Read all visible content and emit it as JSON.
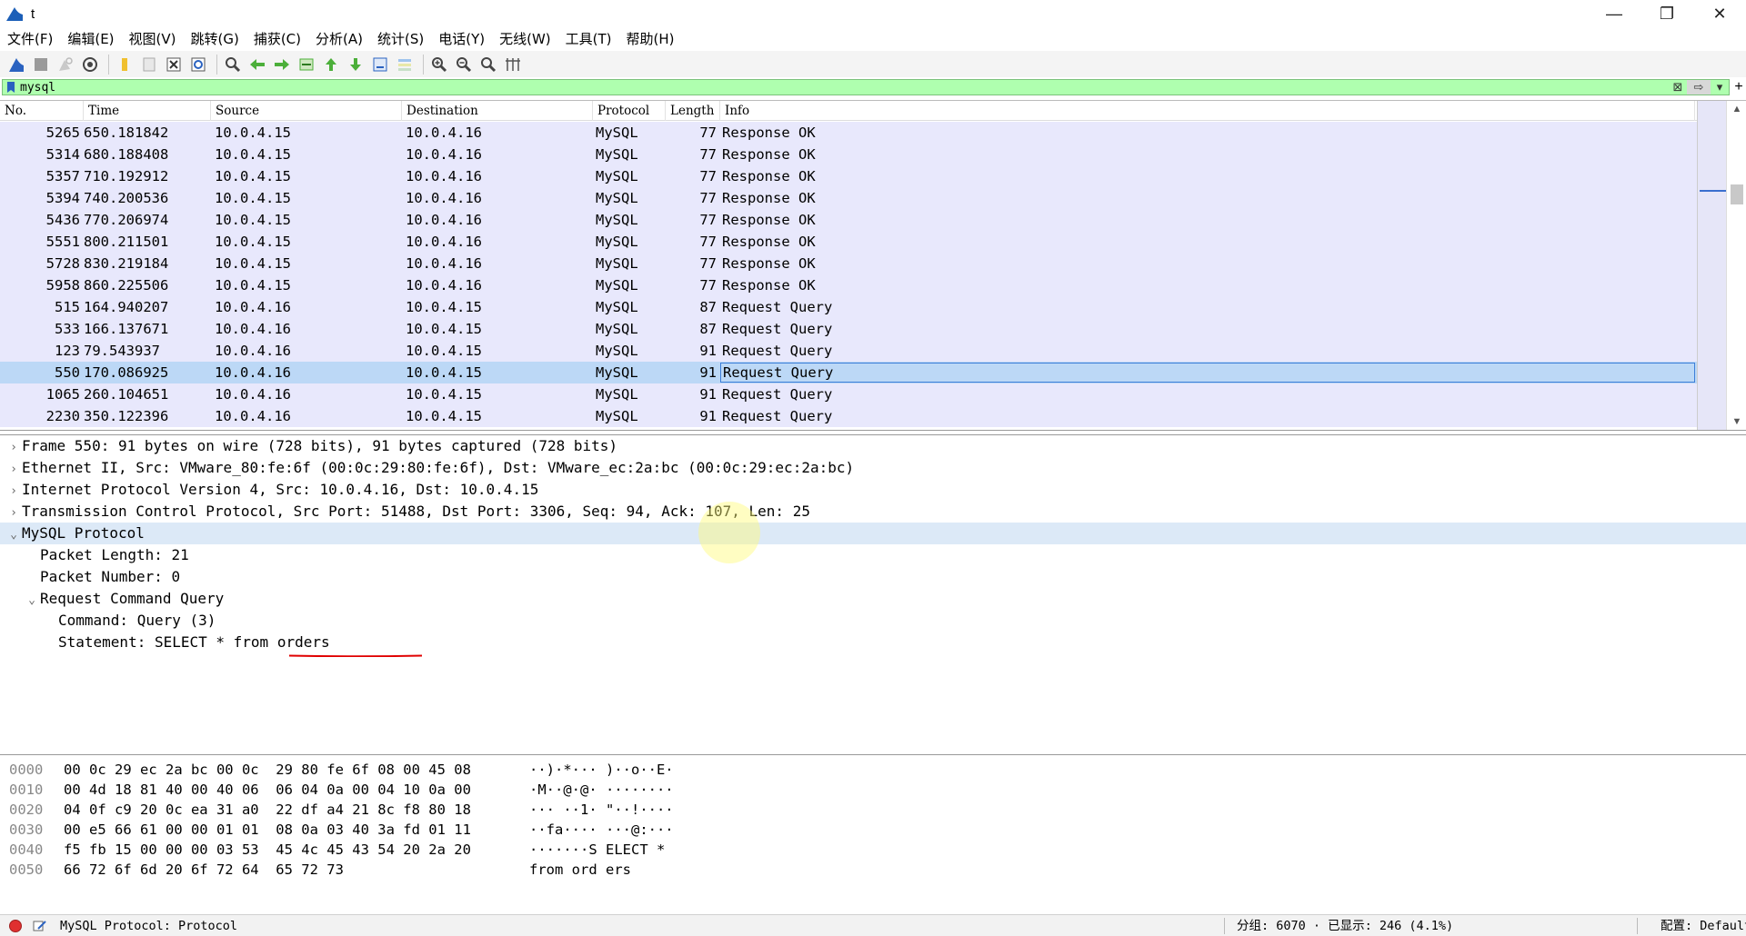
{
  "window": {
    "title": "t",
    "minimize": "—",
    "maximize": "❐",
    "close": "✕"
  },
  "menu": [
    "文件(F)",
    "编辑(E)",
    "视图(V)",
    "跳转(G)",
    "捕获(C)",
    "分析(A)",
    "统计(S)",
    "电话(Y)",
    "无线(W)",
    "工具(T)",
    "帮助(H)"
  ],
  "filter": {
    "value": "mysql",
    "clear": "⊠",
    "apply": "⇨",
    "dropdown": "▾",
    "add": "+"
  },
  "columns": {
    "no": "No.",
    "time": "Time",
    "source": "Source",
    "destination": "Destination",
    "protocol": "Protocol",
    "length": "Length",
    "info": "Info"
  },
  "packets": [
    {
      "no": "5265",
      "time": "650.181842",
      "src": "10.0.4.15",
      "dst": "10.0.4.16",
      "proto": "MySQL",
      "len": "77",
      "info": "Response OK"
    },
    {
      "no": "5314",
      "time": "680.188408",
      "src": "10.0.4.15",
      "dst": "10.0.4.16",
      "proto": "MySQL",
      "len": "77",
      "info": "Response OK"
    },
    {
      "no": "5357",
      "time": "710.192912",
      "src": "10.0.4.15",
      "dst": "10.0.4.16",
      "proto": "MySQL",
      "len": "77",
      "info": "Response OK"
    },
    {
      "no": "5394",
      "time": "740.200536",
      "src": "10.0.4.15",
      "dst": "10.0.4.16",
      "proto": "MySQL",
      "len": "77",
      "info": "Response OK"
    },
    {
      "no": "5436",
      "time": "770.206974",
      "src": "10.0.4.15",
      "dst": "10.0.4.16",
      "proto": "MySQL",
      "len": "77",
      "info": "Response OK"
    },
    {
      "no": "5551",
      "time": "800.211501",
      "src": "10.0.4.15",
      "dst": "10.0.4.16",
      "proto": "MySQL",
      "len": "77",
      "info": "Response OK"
    },
    {
      "no": "5728",
      "time": "830.219184",
      "src": "10.0.4.15",
      "dst": "10.0.4.16",
      "proto": "MySQL",
      "len": "77",
      "info": "Response OK"
    },
    {
      "no": "5958",
      "time": "860.225506",
      "src": "10.0.4.15",
      "dst": "10.0.4.16",
      "proto": "MySQL",
      "len": "77",
      "info": "Response OK"
    },
    {
      "no": "515",
      "time": "164.940207",
      "src": "10.0.4.16",
      "dst": "10.0.4.15",
      "proto": "MySQL",
      "len": "87",
      "info": "Request Query"
    },
    {
      "no": "533",
      "time": "166.137671",
      "src": "10.0.4.16",
      "dst": "10.0.4.15",
      "proto": "MySQL",
      "len": "87",
      "info": "Request Query"
    },
    {
      "no": "123",
      "time": "79.543937",
      "src": "10.0.4.16",
      "dst": "10.0.4.15",
      "proto": "MySQL",
      "len": "91",
      "info": "Request Query"
    },
    {
      "no": "550",
      "time": "170.086925",
      "src": "10.0.4.16",
      "dst": "10.0.4.15",
      "proto": "MySQL",
      "len": "91",
      "info": "Request Query",
      "selected": true
    },
    {
      "no": "1065",
      "time": "260.104651",
      "src": "10.0.4.16",
      "dst": "10.0.4.15",
      "proto": "MySQL",
      "len": "91",
      "info": "Request Query"
    },
    {
      "no": "2230",
      "time": "350.122396",
      "src": "10.0.4.16",
      "dst": "10.0.4.15",
      "proto": "MySQL",
      "len": "91",
      "info": "Request Query"
    }
  ],
  "details": [
    {
      "level": 0,
      "twisty": "collapsed",
      "text": "Frame 550: 91 bytes on wire (728 bits), 91 bytes captured (728 bits)"
    },
    {
      "level": 0,
      "twisty": "collapsed",
      "text": "Ethernet II, Src: VMware_80:fe:6f (00:0c:29:80:fe:6f), Dst: VMware_ec:2a:bc (00:0c:29:ec:2a:bc)"
    },
    {
      "level": 0,
      "twisty": "collapsed",
      "text": "Internet Protocol Version 4, Src: 10.0.4.16, Dst: 10.0.4.15"
    },
    {
      "level": 0,
      "twisty": "collapsed",
      "text": "Transmission Control Protocol, Src Port: 51488, Dst Port: 3306, Seq: 94, Ack: 107, Len: 25"
    },
    {
      "level": 0,
      "twisty": "expanded",
      "text": "MySQL Protocol",
      "highlight": true
    },
    {
      "level": 1,
      "twisty": "none",
      "text": "Packet Length: 21"
    },
    {
      "level": 1,
      "twisty": "none",
      "text": "Packet Number: 0"
    },
    {
      "level": 1,
      "twisty": "expanded",
      "text": "Request Command Query"
    },
    {
      "level": 2,
      "twisty": "none",
      "text": "Command: Query (3)"
    },
    {
      "level": 2,
      "twisty": "none",
      "text": "Statement: SELECT * from orders"
    }
  ],
  "hex": [
    {
      "offset": "0000",
      "bytes": "00 0c 29 ec 2a bc 00 0c  29 80 fe 6f 08 00 45 08",
      "ascii": "··)·*··· )··o··E·"
    },
    {
      "offset": "0010",
      "bytes": "00 4d 18 81 40 00 40 06  06 04 0a 00 04 10 0a 00",
      "ascii": "·M··@·@· ········"
    },
    {
      "offset": "0020",
      "bytes": "04 0f c9 20 0c ea 31 a0  22 df a4 21 8c f8 80 18",
      "ascii": "··· ··1· \"··!····"
    },
    {
      "offset": "0030",
      "bytes": "00 e5 66 61 00 00 01 01  08 0a 03 40 3a fd 01 11",
      "ascii": "··fa···· ···@:···"
    },
    {
      "offset": "0040",
      "bytes": "f5 fb 15 00 00 00 03 53  45 4c 45 43 54 20 2a 20",
      "ascii": "·······S ELECT * "
    },
    {
      "offset": "0050",
      "bytes": "66 72 6f 6d 20 6f 72 64  65 72 73",
      "ascii": "from ord ers"
    }
  ],
  "status": {
    "text": "MySQL Protocol: Protocol",
    "counts": "分组: 6070 · 已显示: 246 (4.1%)",
    "profile": "配置: Default"
  },
  "colors": {
    "filter_ok": "#afffaf",
    "row_bg": "#e8e8fc",
    "row_selected": "#bcd8f6",
    "annotation_red": "#e00000"
  }
}
